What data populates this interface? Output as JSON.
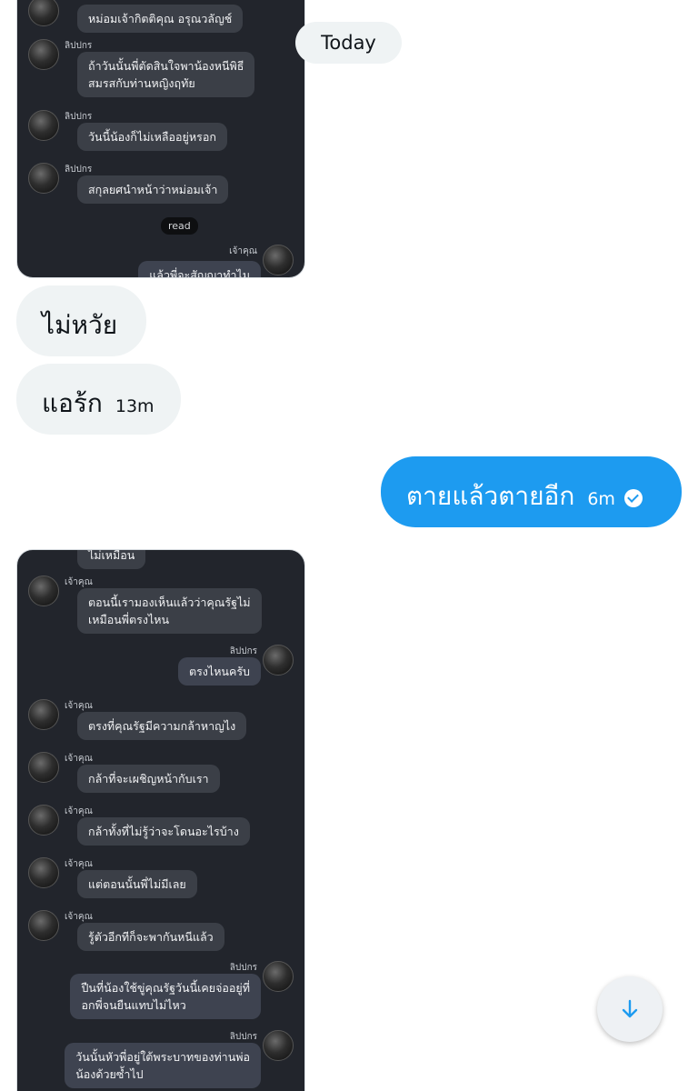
{
  "date_divider": "Today",
  "card_one": {
    "messages": [
      {
        "dir": "in",
        "sender": "",
        "text": "หม่อมเจ้ากิตติคุณ อรุณวลัญช์"
      },
      {
        "dir": "in",
        "sender": "ลิปปกร",
        "text": "ถ้าวันนั้นพี่ตัดสินใจพาน้องหนีพิธี\nสมรสกับท่านหญิงฤทัย"
      },
      {
        "dir": "in",
        "sender": "ลิปปกร",
        "text": "วันนี้น้องก็ไม่เหลืออยู่หรอก"
      },
      {
        "dir": "in",
        "sender": "ลิปปกร",
        "text": "สกุลยศนำหน้าว่าหม่อมเจ้า"
      },
      {
        "dir": "status",
        "text": "read"
      },
      {
        "dir": "out",
        "sender": "เจ้าคุณ",
        "text": "แล้วพี่จะสัญญาทำไม"
      }
    ]
  },
  "dm_messages": [
    {
      "dir": "in",
      "text": "ไม่หวัย",
      "time": ""
    },
    {
      "dir": "in",
      "text": "แอร้ก",
      "time": "13m"
    },
    {
      "dir": "out",
      "text": "ตายแล้วตายอีก",
      "time": "6m",
      "status_icon": "check-circle-icon"
    }
  ],
  "card_two": {
    "messages": [
      {
        "dir": "in",
        "sender": "",
        "text": "ไม่เหมือน"
      },
      {
        "dir": "in",
        "sender": "เจ้าคุณ",
        "text": "ตอนนี้เรามองเห็นแล้วว่าคุณรัฐไม่\nเหมือนพี่ตรงไหน"
      },
      {
        "dir": "out",
        "sender": "ลิปปกร",
        "text": "ตรงไหนครับ"
      },
      {
        "dir": "in",
        "sender": "เจ้าคุณ",
        "text": "ตรงที่คุณรัฐมีความกล้าหาญไง"
      },
      {
        "dir": "in",
        "sender": "เจ้าคุณ",
        "text": "กล้าที่จะเผชิญหน้ากับเรา"
      },
      {
        "dir": "in",
        "sender": "เจ้าคุณ",
        "text": "กล้าทั้งที่ไม่รู้ว่าจะโดนอะไรบ้าง"
      },
      {
        "dir": "in",
        "sender": "เจ้าคุณ",
        "text": "แต่ตอนนั้นพี่ไม่มีเลย"
      },
      {
        "dir": "in",
        "sender": "เจ้าคุณ",
        "text": "รู้ตัวอีกทีก็จะพากันหนีแล้ว"
      },
      {
        "dir": "out",
        "sender": "ลิปปกร",
        "text": "ปืนที่น้องใช้ขู่คุณรัฐวันนี้เคยจ่ออยู่ที่\nอกพี่จนยืนแทบไม่ไหว"
      },
      {
        "dir": "out",
        "sender": "ลิปปกร",
        "text": "วันนั้นหัวพี่อยู่ใต้พระบาทของท่านพ่อ\nน้องด้วยซ้ำไป"
      }
    ]
  },
  "colors": {
    "sent_bubble": "#1d9bf0",
    "received_bubble": "#eff3f4",
    "card_background": "#22252c"
  },
  "scroll_button_icon": "arrow-down-icon"
}
